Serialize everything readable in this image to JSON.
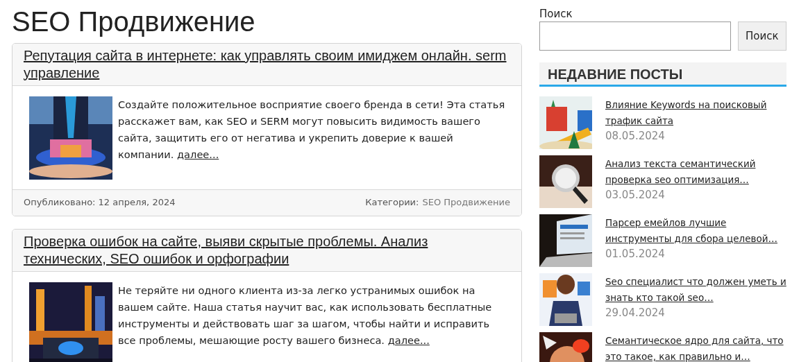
{
  "page_title": "SEO Продвижение",
  "posts": [
    {
      "title": "Репутация сайта в интернете: как управлять своим имиджем онлайн. serm управление",
      "excerpt": "Создайте положительное восприятие своего бренда в сети! Эта статья расскажет вам, как SEO и SERM могут повысить видимость вашего сайта, защитить его от негатива и укрепить доверие к вашей компании.",
      "more": "далее...",
      "published": "Опубликовано: 12 апреля, 2024",
      "categories_label": "Категории:",
      "category": "SEO Продвижение"
    },
    {
      "title": "Проверка ошибок на сайте, выяви скрытые проблемы. Анализ технических, SEO ошибок и орфографии",
      "excerpt": "Не теряйте ни одного клиента из-за легко устранимых ошибок на вашем сайте. Наша статья научит вас, как использовать бесплатные инструменты и действовать шаг за шагом, чтобы найти и исправить все проблемы, мешающие росту вашего бизнеса.",
      "more": "далее..."
    }
  ],
  "sidebar": {
    "search": {
      "label": "Поиск",
      "button": "Поиск"
    },
    "recent_title": "НЕДАВНИЕ ПОСТЫ",
    "recent": [
      {
        "title": "Влияние Keywords на поисковый трафик сайта",
        "date": "08.05.2024"
      },
      {
        "title": "Анализ текста семантический проверка seo оптимизация…",
        "date": "03.05.2024"
      },
      {
        "title": "Парсер емейлов лучшие инструменты для сбора целевой…",
        "date": "01.05.2024"
      },
      {
        "title": "Seo специалист что должен уметь и знать кто такой seo…",
        "date": "29.04.2024"
      },
      {
        "title": "Семантическое ядро для сайта, что это такое, как правильно и…"
      }
    ]
  }
}
